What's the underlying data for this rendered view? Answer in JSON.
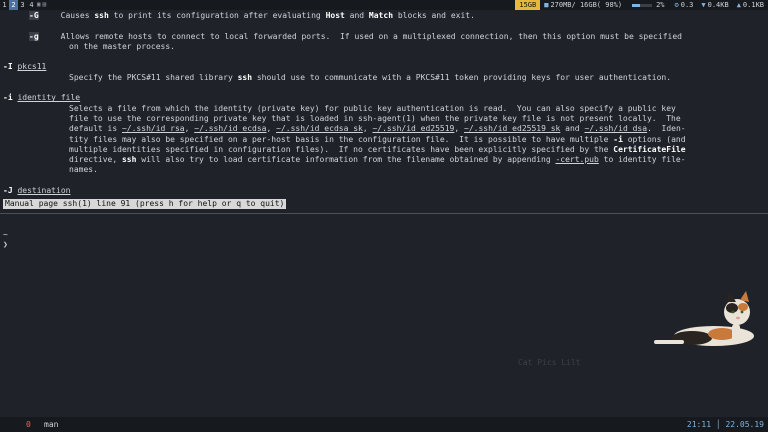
{
  "topbar": {
    "workspaces": [
      "1",
      "2",
      "3",
      "4"
    ],
    "active_workspace": "2",
    "memory_badge": "15GB",
    "ram_text": "270MB/ 16GB( 98%)",
    "cpu_text": "2%",
    "temp_text": "0.3",
    "net_down": "0.4KB",
    "net_up": "0.1KB",
    "colors": {
      "accent": "#4e6fa6",
      "badge": "#e6b93b",
      "icon": "#7fb4e0"
    }
  },
  "man": {
    "line1_opt": "-G",
    "line1_text_a": "Causes ",
    "line1_bold1": "ssh",
    "line1_text_b": " to print its configuration after evaluating ",
    "line1_bold2": "Host",
    "line1_text_c": " and ",
    "line1_bold3": "Match",
    "line1_text_d": " blocks and exit.",
    "g_opt": "-g",
    "g_line1": "Allows remote hosts to connect to local forwarded ports.  If used on a multiplexed connection, then this option must be specified",
    "g_line2": "on the master process.",
    "i_opt": "-I",
    "i_arg": "pkcs11",
    "i_text_a": "Specify the PKCS#11 shared library ",
    "i_bold": "ssh",
    "i_text_b": " should use to communicate with a PKCS#11 token providing keys for user authentication.",
    "iid_opt": "-i",
    "iid_arg": "identity_file",
    "iid_l1": "Selects a file from which the identity (private key) for public key authentication is read.  You can also specify a public key",
    "iid_l2": "file to use the corresponding private key that is loaded in ssh-agent(1) when the private key file is not present locally.  The",
    "iid_l3_a": "default is ",
    "iid_f1": "~/.ssh/id_rsa",
    "iid_f2": "~/.ssh/id_ecdsa",
    "iid_f3": "~/.ssh/id_ecdsa_sk",
    "iid_f4": "~/.ssh/id_ed25519",
    "iid_f5": "~/.ssh/id_ed25519_sk",
    "iid_and": " and ",
    "iid_f6": "~/.ssh/id_dsa",
    "iid_l3_end": ".  Iden-",
    "iid_l4_a": "tity files may also be specified on a per-host basis in the configuration file.  It is possible to have multiple ",
    "iid_l4_bold": "-i",
    "iid_l4_b": " options (and",
    "iid_l5_a": "multiple identities specified in configuration files).  If no certificates have been explicitly specified by the ",
    "iid_l5_bold": "CertificateFile",
    "iid_l6_a": "directive, ",
    "iid_l6_bold": "ssh",
    "iid_l6_b": " will also try to load certificate information from the filename obtained by appending ",
    "iid_l6_u": "-cert.pub",
    "iid_l6_c": " to identity file-",
    "iid_l7": "names.",
    "j_opt": "-J",
    "j_arg": "destination"
  },
  "status_line": "Manual page ssh(1) line 91 (press h for help or q to quit)",
  "prompt": {
    "tilde": "~",
    "arrow": "❯"
  },
  "watermark": "Cat Pics Lilt",
  "bottombar": {
    "window_index": "0",
    "window_name": "man",
    "time": "21:11",
    "date": "22.05.19"
  }
}
